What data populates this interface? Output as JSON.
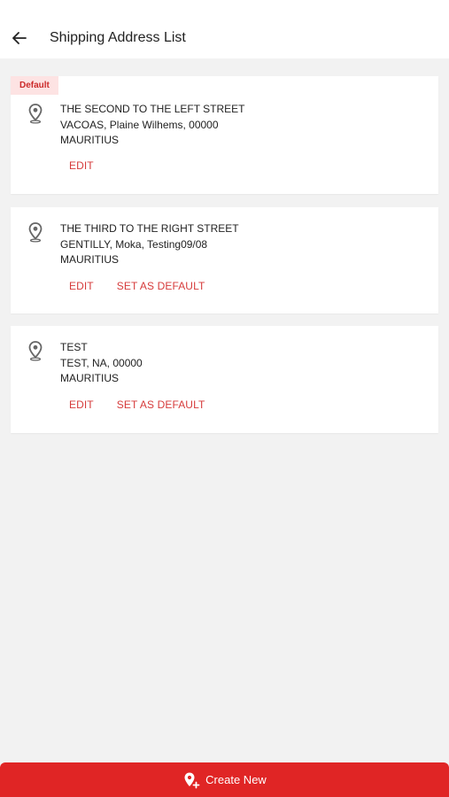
{
  "header": {
    "title": "Shipping Address List"
  },
  "addresses": [
    {
      "badge": "Default",
      "line1": "THE SECOND TO THE LEFT STREET",
      "line2": "VACOAS, Plaine Wilhems, 00000",
      "country": "MAURITIUS",
      "edit_label": "EDIT"
    },
    {
      "line1": "THE THIRD TO THE RIGHT STREET",
      "line2": "GENTILLY, Moka, Testing09/08",
      "country": "MAURITIUS",
      "edit_label": "EDIT",
      "default_label": "SET AS DEFAULT"
    },
    {
      "line1": "TEST",
      "line2": "TEST, NA, 00000",
      "country": "MAURITIUS",
      "edit_label": "EDIT",
      "default_label": "SET AS DEFAULT"
    }
  ],
  "footer": {
    "create_label": "Create New"
  },
  "colors": {
    "accent": "#e02525",
    "action_text": "#d63b3b",
    "badge_bg": "#fde3e3"
  },
  "icons": {
    "back": "arrow-left-icon",
    "pin": "location-pin-icon",
    "add_location": "add-location-icon"
  }
}
